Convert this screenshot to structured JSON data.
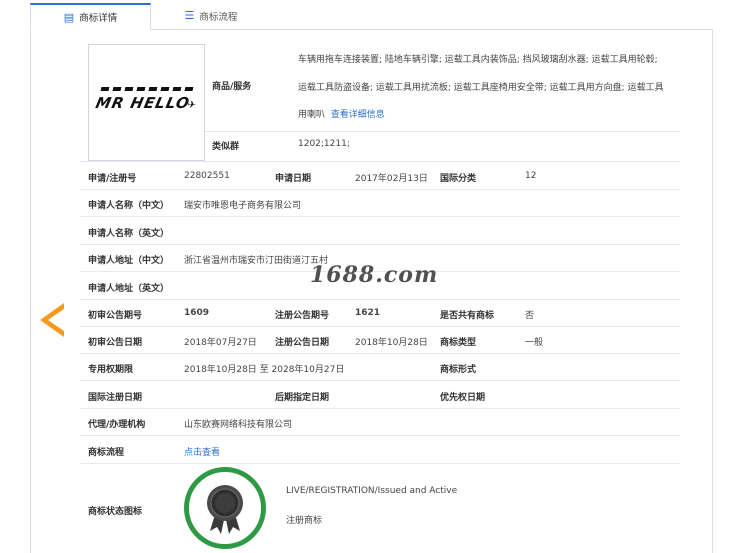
{
  "tabs": [
    {
      "label": "商标详情",
      "active": true
    },
    {
      "label": "商标流程",
      "active": false
    }
  ],
  "logo": {
    "text": "MR HELLO"
  },
  "goods": {
    "label": "商品/服务",
    "text": "车辆用拖车连接装置; 陆地车辆引擎; 运载工具内装饰品; 挡风玻璃刮水器; 运载工具用轮毂; 运载工具防盗设备; 运载工具用扰流板; 运载工具座椅用安全带; 运载工具用方向盘; 运载工具用喇叭",
    "more_link": "查看详细信息"
  },
  "similar_group": {
    "label": "类似群",
    "value": "1202;1211;"
  },
  "reg_no": {
    "label": "申请/注册号",
    "value": "22802551"
  },
  "apply_date": {
    "label": "申请日期",
    "value": "2017年02月13日"
  },
  "intl_class": {
    "label": "国际分类",
    "value": "12"
  },
  "applicant_cn": {
    "label": "申请人名称（中文）",
    "value": "瑞安市唯恩电子商务有限公司"
  },
  "applicant_en": {
    "label": "申请人名称（英文）",
    "value": ""
  },
  "address_cn": {
    "label": "申请人地址（中文）",
    "value": "浙江省温州市瑞安市汀田街道汀五村"
  },
  "address_en": {
    "label": "申请人地址（英文）",
    "value": ""
  },
  "prelim_issue": {
    "label": "初审公告期号",
    "value": "1609"
  },
  "reg_issue": {
    "label": "注册公告期号",
    "value": "1621"
  },
  "shared": {
    "label": "是否共有商标",
    "value": "否"
  },
  "prelim_date": {
    "label": "初审公告日期",
    "value": "2018年07月27日"
  },
  "reg_date": {
    "label": "注册公告日期",
    "value": "2018年10月28日"
  },
  "tm_type": {
    "label": "商标类型",
    "value": "一般"
  },
  "exclusive": {
    "label": "专用权期限",
    "value": "2018年10月28日 至 2028年10月27日"
  },
  "tm_form": {
    "label": "商标形式",
    "value": ""
  },
  "intl_reg_date": {
    "label": "国际注册日期",
    "value": ""
  },
  "later_date": {
    "label": "后期指定日期",
    "value": ""
  },
  "priority_date": {
    "label": "优先权日期",
    "value": ""
  },
  "agent": {
    "label": "代理/办理机构",
    "value": "山东欧赛网络科技有限公司"
  },
  "process": {
    "label": "商标流程",
    "link": "点击查看"
  },
  "status": {
    "label": "商标状态图标",
    "en": "LIVE/REGISTRATION/Issued and Active",
    "cn": "注册商标"
  },
  "watermark": "1688.com",
  "colors": {
    "accent": "#2b6fd0",
    "badge_green": "#2f9a45",
    "arrow": "#f29b1e"
  }
}
